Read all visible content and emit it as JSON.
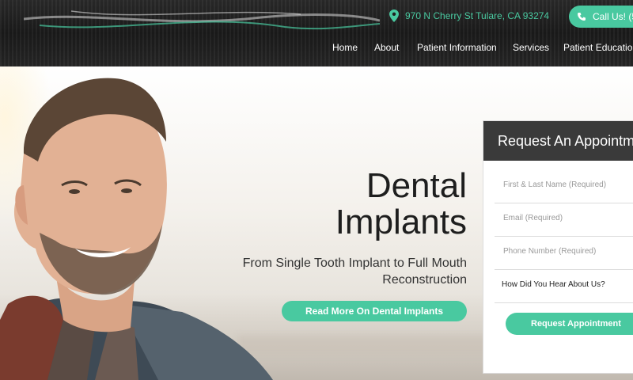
{
  "header": {
    "address": "970 N Cherry St Tulare, CA 93274",
    "call_label": "Call Us! (5",
    "nav": [
      "Home",
      "About",
      "Patient Information",
      "Services",
      "Patient Education"
    ]
  },
  "hero": {
    "title_line1": "Dental",
    "title_line2": "Implants",
    "subtitle": "From Single Tooth Implant to Full Mouth Reconstruction",
    "button_label": "Read More On Dental Implants"
  },
  "form": {
    "heading": "Request An Appointment",
    "name_placeholder": "First & Last Name (Required)",
    "email_placeholder": "Email (Required)",
    "phone_placeholder": "Phone Number (Required)",
    "referral_label": "How Did You Hear About Us?",
    "submit_label": "Request Appointment"
  },
  "colors": {
    "accent": "#49c9a0",
    "header_bg": "#1f1f1f",
    "form_head_bg": "#3a3a3a"
  }
}
